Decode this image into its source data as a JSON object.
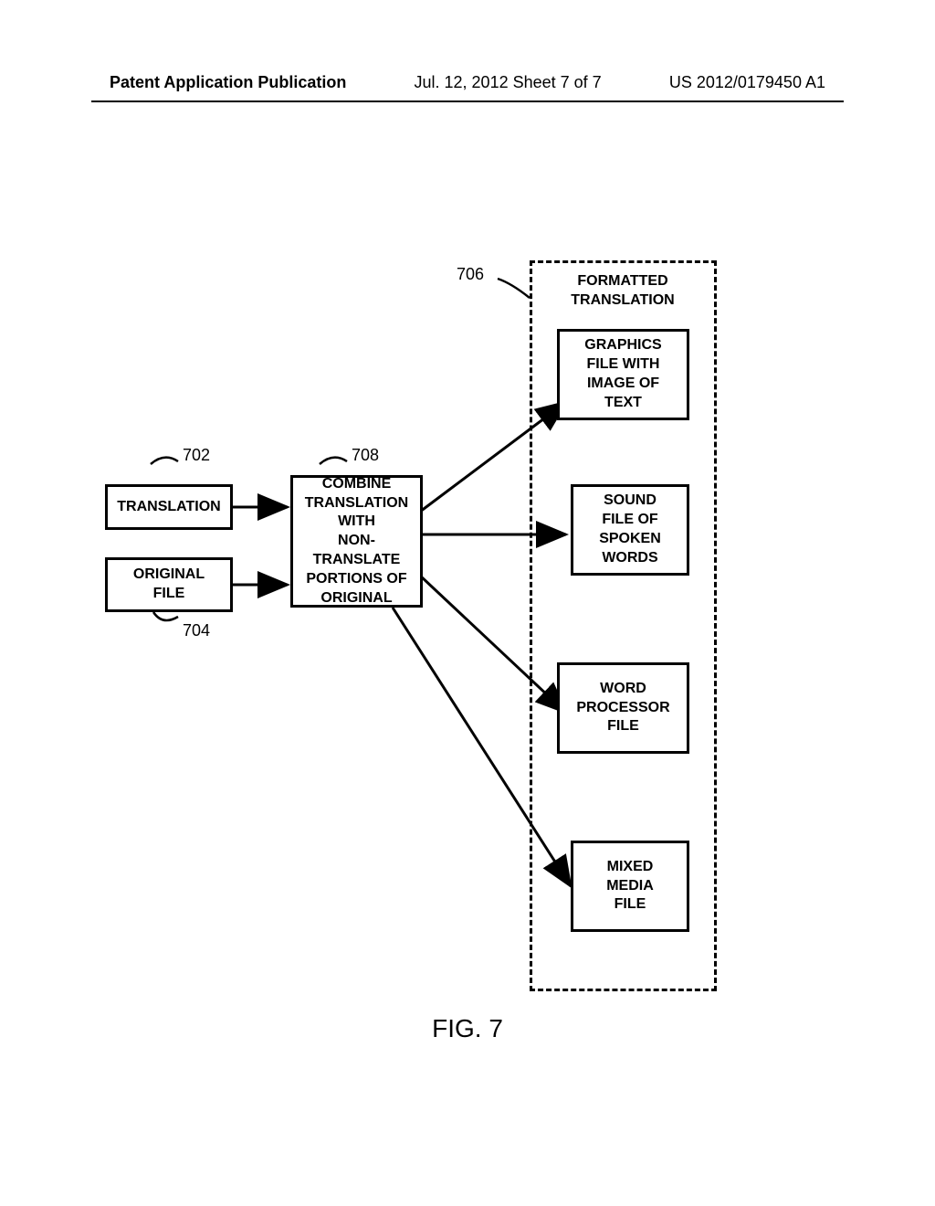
{
  "header": {
    "left": "Patent Application Publication",
    "center": "Jul. 12, 2012  Sheet 7 of 7",
    "right": "US 2012/0179450 A1"
  },
  "refs": {
    "r702": "702",
    "r704": "704",
    "r706": "706",
    "r708": "708"
  },
  "boxes": {
    "translation": "TRANSLATION",
    "original_file": "ORIGINAL\nFILE",
    "combine": "COMBINE\nTRANSLATION\nWITH\nNON-TRANSLATE\nPORTIONS OF\nORIGINAL",
    "container_title": "FORMATTED\nTRANSLATION",
    "graphics": "GRAPHICS\nFILE WITH\nIMAGE OF\nTEXT",
    "sound": "SOUND\nFILE OF\nSPOKEN\nWORDS",
    "word_proc": "WORD\nPROCESSOR\nFILE",
    "mixed": "MIXED\nMEDIA\nFILE"
  },
  "figure_label": "FIG. 7"
}
